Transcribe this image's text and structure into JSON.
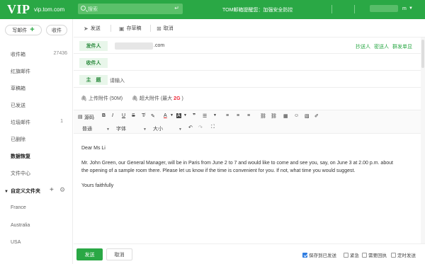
{
  "header": {
    "logo": "VIP",
    "domain": "vip.tom.com",
    "search_placeholder": "搜索",
    "notice": "TOM邮箱提醒您：加强安全防控",
    "user_suffix": "m"
  },
  "sidebar": {
    "compose_label": "写邮件",
    "receive_label": "收件",
    "items": [
      {
        "label": "收件箱",
        "count": "27436"
      },
      {
        "label": "红旗邮件",
        "count": ""
      },
      {
        "label": "草稿箱",
        "count": ""
      },
      {
        "label": "已发送",
        "count": ""
      },
      {
        "label": "垃圾邮件",
        "count": "1"
      },
      {
        "label": "已删除",
        "count": ""
      },
      {
        "label": "数据恢复",
        "count": ""
      },
      {
        "label": "文件中心",
        "count": ""
      }
    ],
    "custom_folders_label": "自定义文件夹",
    "custom_folders": [
      "France",
      "Australia",
      "USA"
    ]
  },
  "toolbar": {
    "send": "发送",
    "save_draft": "存草稿",
    "cancel": "取消"
  },
  "compose": {
    "from_label": "发件人",
    "from_domain": ".com",
    "to_label": "收件人",
    "cc_link": "抄送人",
    "bcc_link": "密送人",
    "group_send_link": "群发单显",
    "subject_label": "主　题",
    "subject_placeholder": "请输入",
    "attach_label": "上传附件 (50M)",
    "big_attach_label": "超大附件 (最大",
    "big_attach_size": "2G",
    "big_attach_close": ")"
  },
  "editor": {
    "source_label": "源码",
    "font_style_select": "普通",
    "font_family_select": "字体",
    "font_size_select": "大小"
  },
  "email_body": {
    "greeting": "Dear Ms Li",
    "line1": "Mr. John Green, our General Manager, will be in Paris from June 2 to 7 and would like to come and see you, say, on June 3 at 2.00 p.m. about",
    "line2": "the opening of a sample room there. Please let us know if the time is convenient for you. If not, what time you would suggest.",
    "closing": "Yours faithfully"
  },
  "footer": {
    "send": "发送",
    "cancel": "取消",
    "options": [
      {
        "label": "保存到已发送",
        "checked": true
      },
      {
        "label": "紧急",
        "checked": false
      },
      {
        "label": "需要回执",
        "checked": false
      },
      {
        "label": "定时发送",
        "checked": false
      }
    ]
  },
  "colors": {
    "brand_green": "#2aa845",
    "label_bg": "#e8f6ea",
    "checkbox_blue": "#2f7de1"
  }
}
